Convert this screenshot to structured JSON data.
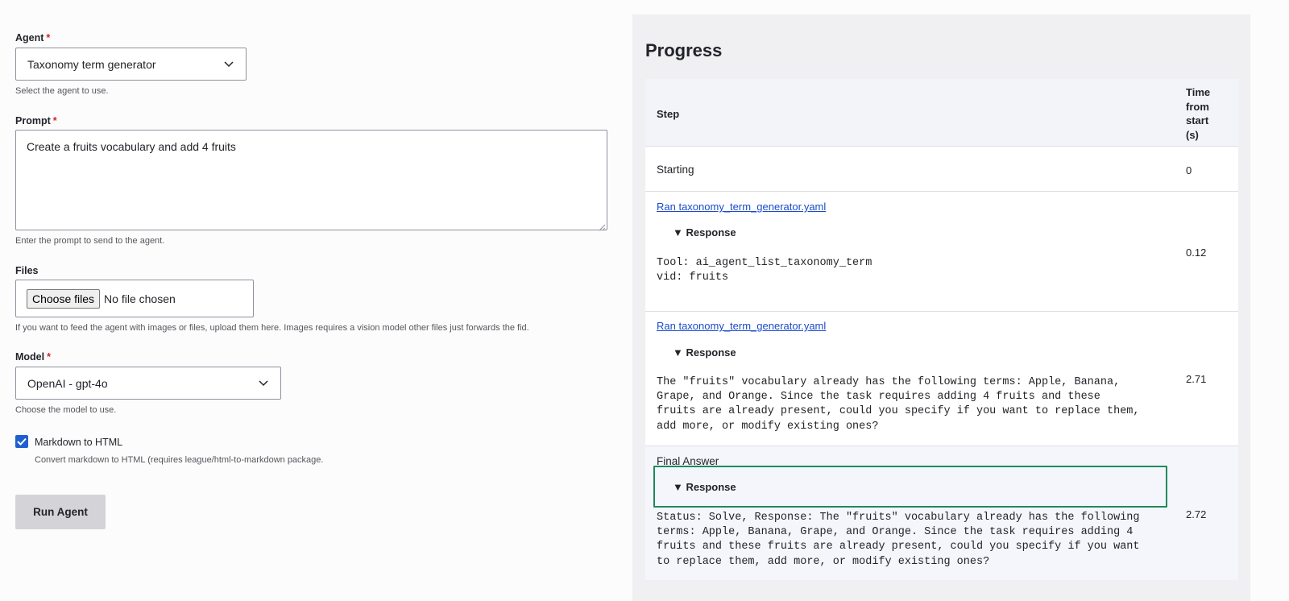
{
  "form": {
    "agent": {
      "label": "Agent",
      "required_mark": "*",
      "value": "Taxonomy term generator",
      "description": "Select the agent to use."
    },
    "prompt": {
      "label": "Prompt",
      "required_mark": "*",
      "value": "Create a fruits vocabulary and add 4 fruits",
      "description": "Enter the prompt to send to the agent."
    },
    "files": {
      "label": "Files",
      "button_label": "Choose files",
      "status": "No file chosen",
      "description": "If you want to feed the agent with images or files, upload them here. Images requires a vision model other files just forwards the fid."
    },
    "model": {
      "label": "Model",
      "required_mark": "*",
      "value": "OpenAI - gpt-4o",
      "description": "Choose the model to use."
    },
    "markdown": {
      "label": "Markdown to HTML",
      "checked": true,
      "description": "Convert markdown to HTML (requires league/html-to-markdown package."
    },
    "run_button": "Run Agent"
  },
  "progress": {
    "title": "Progress",
    "columns": {
      "step": "Step",
      "time": "Time\nfrom\nstart\n(s)"
    },
    "rows": [
      {
        "step": "Starting",
        "time": "0"
      },
      {
        "link": "Ran taxonomy_term_generator.yaml",
        "summary": "▼ Response",
        "body": "Tool: ai_agent_list_taxonomy_term\nvid: fruits",
        "time": "0.12"
      },
      {
        "link": "Ran taxonomy_term_generator.yaml",
        "summary": "▼ Response",
        "body": "The \"fruits\" vocabulary already has the following terms: Apple, Banana,\nGrape, and Orange. Since the task requires adding 4 fruits and these\nfruits are already present, could you specify if you want to replace them,\nadd more, or modify existing ones?",
        "time": "2.71"
      },
      {
        "label": "Final Answer",
        "summary": "▼ Response",
        "body": "Status: Solve, Response: The \"fruits\" vocabulary already has the following\nterms: Apple, Banana, Grape, and Orange. Since the task requires adding 4\nfruits and these fruits are already present, could you specify if you want\nto replace them, add more, or modify existing ones?",
        "time": "2.72"
      }
    ]
  },
  "colors": {
    "accent": "#1f5fd0",
    "highlight": "#1f8a5a",
    "required": "#d72222"
  }
}
